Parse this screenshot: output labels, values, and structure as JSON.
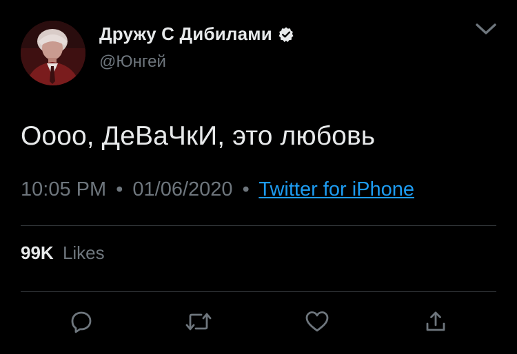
{
  "user": {
    "display_name": "Дружу С Дибилами",
    "handle": "@Юнгей",
    "avatar_icon": "avatar-photo",
    "verified_icon": "verified-badge-icon"
  },
  "tweet": {
    "text": "Оооо, ДеВаЧкИ, это любовь",
    "time": "10:05 PM",
    "date": "01/06/2020",
    "separator": "•",
    "source": "Twitter for iPhone"
  },
  "stats": {
    "likes_count": "99K",
    "likes_label": "Likes"
  },
  "actions": [
    {
      "name": "reply",
      "icon": "reply-icon"
    },
    {
      "name": "retweet",
      "icon": "retweet-icon"
    },
    {
      "name": "like",
      "icon": "heart-icon"
    },
    {
      "name": "share",
      "icon": "share-icon"
    }
  ],
  "colors": {
    "background": "#000000",
    "text_primary": "#e7e9ea",
    "text_secondary": "#6e767d",
    "link": "#1d9bf0",
    "divider": "#2f3336"
  }
}
